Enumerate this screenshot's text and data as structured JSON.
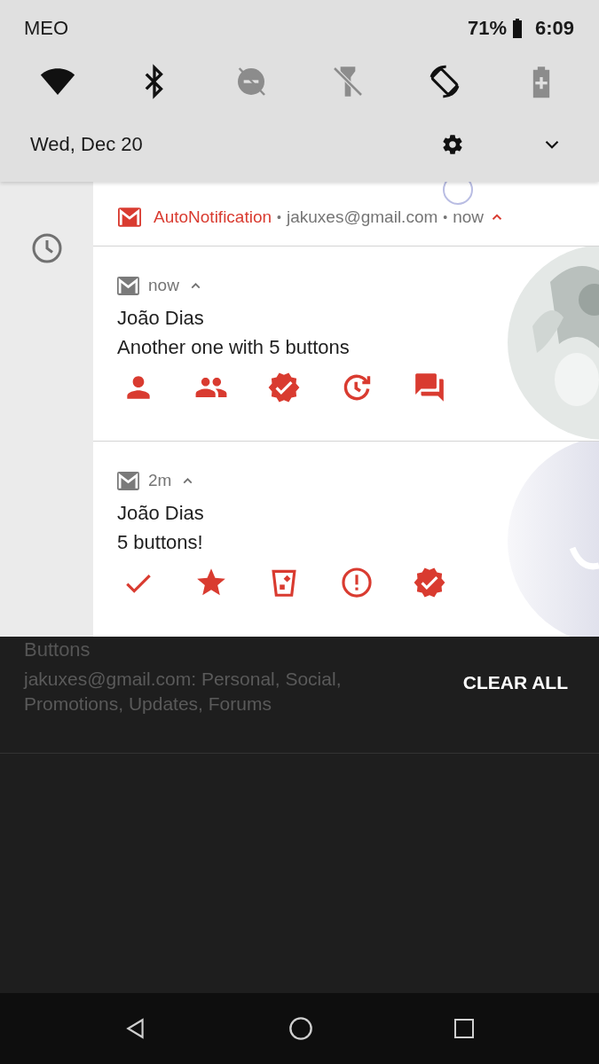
{
  "status_bar": {
    "carrier": "MEO",
    "battery": "71%",
    "time": "6:09"
  },
  "quick_settings": {
    "tiles": [
      {
        "kind": "wifi",
        "on": true
      },
      {
        "kind": "bluetooth",
        "on": true
      },
      {
        "kind": "dnd",
        "on": false
      },
      {
        "kind": "flashlight",
        "on": false
      },
      {
        "kind": "rotate",
        "on": true
      },
      {
        "kind": "battery_saver",
        "on": false
      }
    ],
    "date": "Wed, Dec 20"
  },
  "notification_group": {
    "app": "AutoNotification",
    "account": "jakuxes@gmail.com",
    "separator": "•",
    "time": "now",
    "expanded": true,
    "notifications": [
      {
        "time": "now",
        "expanded": true,
        "title": "João Dias",
        "text": "Another one with 5 buttons",
        "large_icon": {
          "kind": "picture"
        },
        "actions": [
          {
            "kind": "person"
          },
          {
            "kind": "people"
          },
          {
            "kind": "verified"
          },
          {
            "kind": "snooze"
          },
          {
            "kind": "forum"
          }
        ]
      },
      {
        "time": "2m",
        "expanded": true,
        "title": "João Dias",
        "text": "5 buttons!",
        "large_icon": {
          "kind": "picture"
        },
        "actions": [
          {
            "kind": "check"
          },
          {
            "kind": "star"
          },
          {
            "kind": "delete"
          },
          {
            "kind": "report"
          },
          {
            "kind": "verified"
          }
        ]
      }
    ]
  },
  "background_app": {
    "title": "Buttons",
    "summary": "jakuxes@gmail.com: Personal, Social, Promotions, Updates, Forums"
  },
  "clear_all": "CLEAR ALL"
}
